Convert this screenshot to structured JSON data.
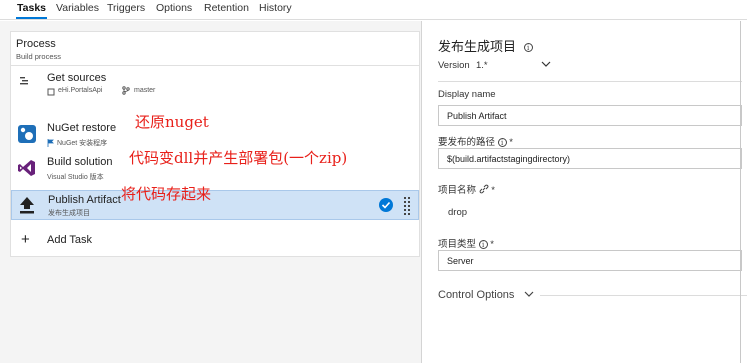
{
  "tabs": [
    {
      "label": "Tasks",
      "active": true
    },
    {
      "label": "Variables"
    },
    {
      "label": "Triggers"
    },
    {
      "label": "Options"
    },
    {
      "label": "Retention"
    },
    {
      "label": "History"
    }
  ],
  "process": {
    "title": "Process",
    "subtitle": "Build process"
  },
  "tasks": [
    {
      "name": "Get sources",
      "sub": "eHi.PortalsApi",
      "branch": "master",
      "icon": "get-sources-icon"
    },
    {
      "name": "NuGet restore",
      "sub": "NuGet 安装程序",
      "icon": "nuget-icon",
      "annotation": "还原nuget"
    },
    {
      "name": "Build solution",
      "sub": "Visual Studio 版本",
      "icon": "visual-studio-icon",
      "annotation": "代码变dll并产生部署包(一个zip)"
    },
    {
      "name": "Publish Artifact",
      "sub": "发布生成项目",
      "icon": "upload-arrow-icon",
      "annotation": "将代码存起来",
      "selected": true
    }
  ],
  "add_task_label": "Add Task",
  "details": {
    "title": "发布生成项目",
    "version_label": "Version",
    "version_value": "1.*",
    "display_name_label": "Display name",
    "display_name_value": "Publish Artifact",
    "path_label": "要发布的路径",
    "path_value": "$(build.artifactstagingdirectory)",
    "item_name_label": "项目名称",
    "item_name_value": "drop",
    "item_type_label": "项目类型",
    "item_type_value": "Server",
    "control_options_label": "Control Options",
    "required_mark": "*"
  },
  "colors": {
    "accent": "#0078d7",
    "annotation": "#e8201a",
    "selected_row": "#cfe2f6"
  }
}
